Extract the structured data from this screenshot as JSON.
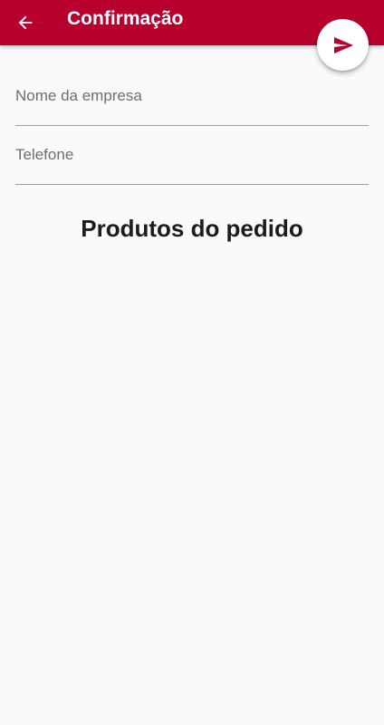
{
  "app_bar": {
    "title": "Confirmação",
    "background_color": "#b8002f",
    "back_icon": "arrow-back-icon"
  },
  "fab": {
    "icon": "send-icon",
    "icon_color": "#b8002f"
  },
  "form": {
    "company_name": {
      "placeholder": "Nome da empresa",
      "value": ""
    },
    "phone": {
      "placeholder": "Telefone",
      "value": ""
    }
  },
  "products_section": {
    "heading": "Produtos do pedido"
  }
}
